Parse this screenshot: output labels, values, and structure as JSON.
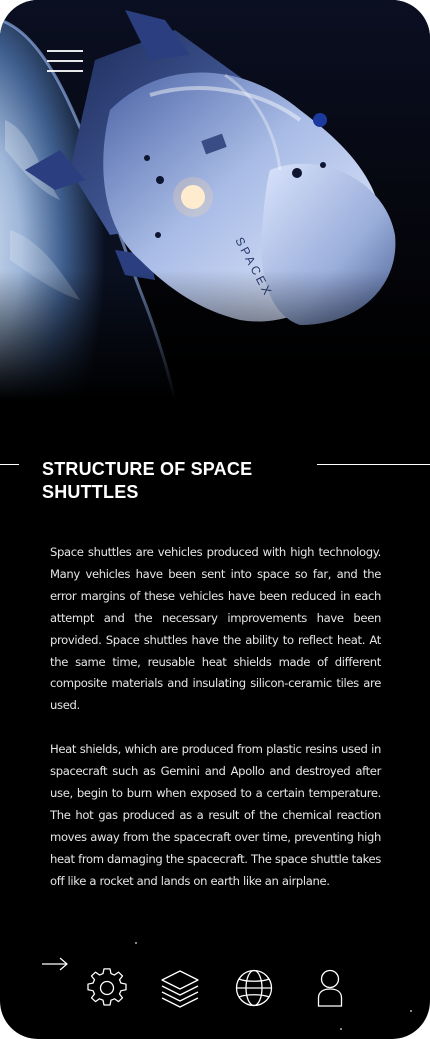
{
  "article": {
    "title": "STRUCTURE OF SPACE SHUTTLES",
    "paragraphs": [
      "Space shuttles are vehicles produced with high technology. Many vehicles have been sent into space so far, and the error margins of these vehicles have been reduced in each attempt and the necessary improvements have been provided. Space shuttles have the ability to reflect heat. At the same time, reusable heat shields made of different composite materials and insulating silicon-ceramic tiles are used.",
      "Heat shields, which are produced from plastic resins used in spacecraft such as Gemini and Apollo and destroyed after use, begin to burn when exposed to a certain temperature. The hot gas produced as a result of the chemical reaction moves away from the spacecraft over time, preventing high heat from damaging the spacecraft. The space shuttle takes off like a rocket and lands on earth like an airplane."
    ]
  },
  "hero": {
    "capsule_text": "SPACEX"
  },
  "bottom_nav": {
    "items": [
      {
        "name": "settings",
        "icon": "gear-icon"
      },
      {
        "name": "layers",
        "icon": "layers-icon"
      },
      {
        "name": "explore",
        "icon": "globe-icon"
      },
      {
        "name": "profile",
        "icon": "user-icon"
      }
    ],
    "back_icon": "arrow-right-icon",
    "menu_icon": "hamburger-icon"
  },
  "colors": {
    "background": "#000000",
    "text": "#ffffff",
    "body_text": "#e6e6e6"
  }
}
